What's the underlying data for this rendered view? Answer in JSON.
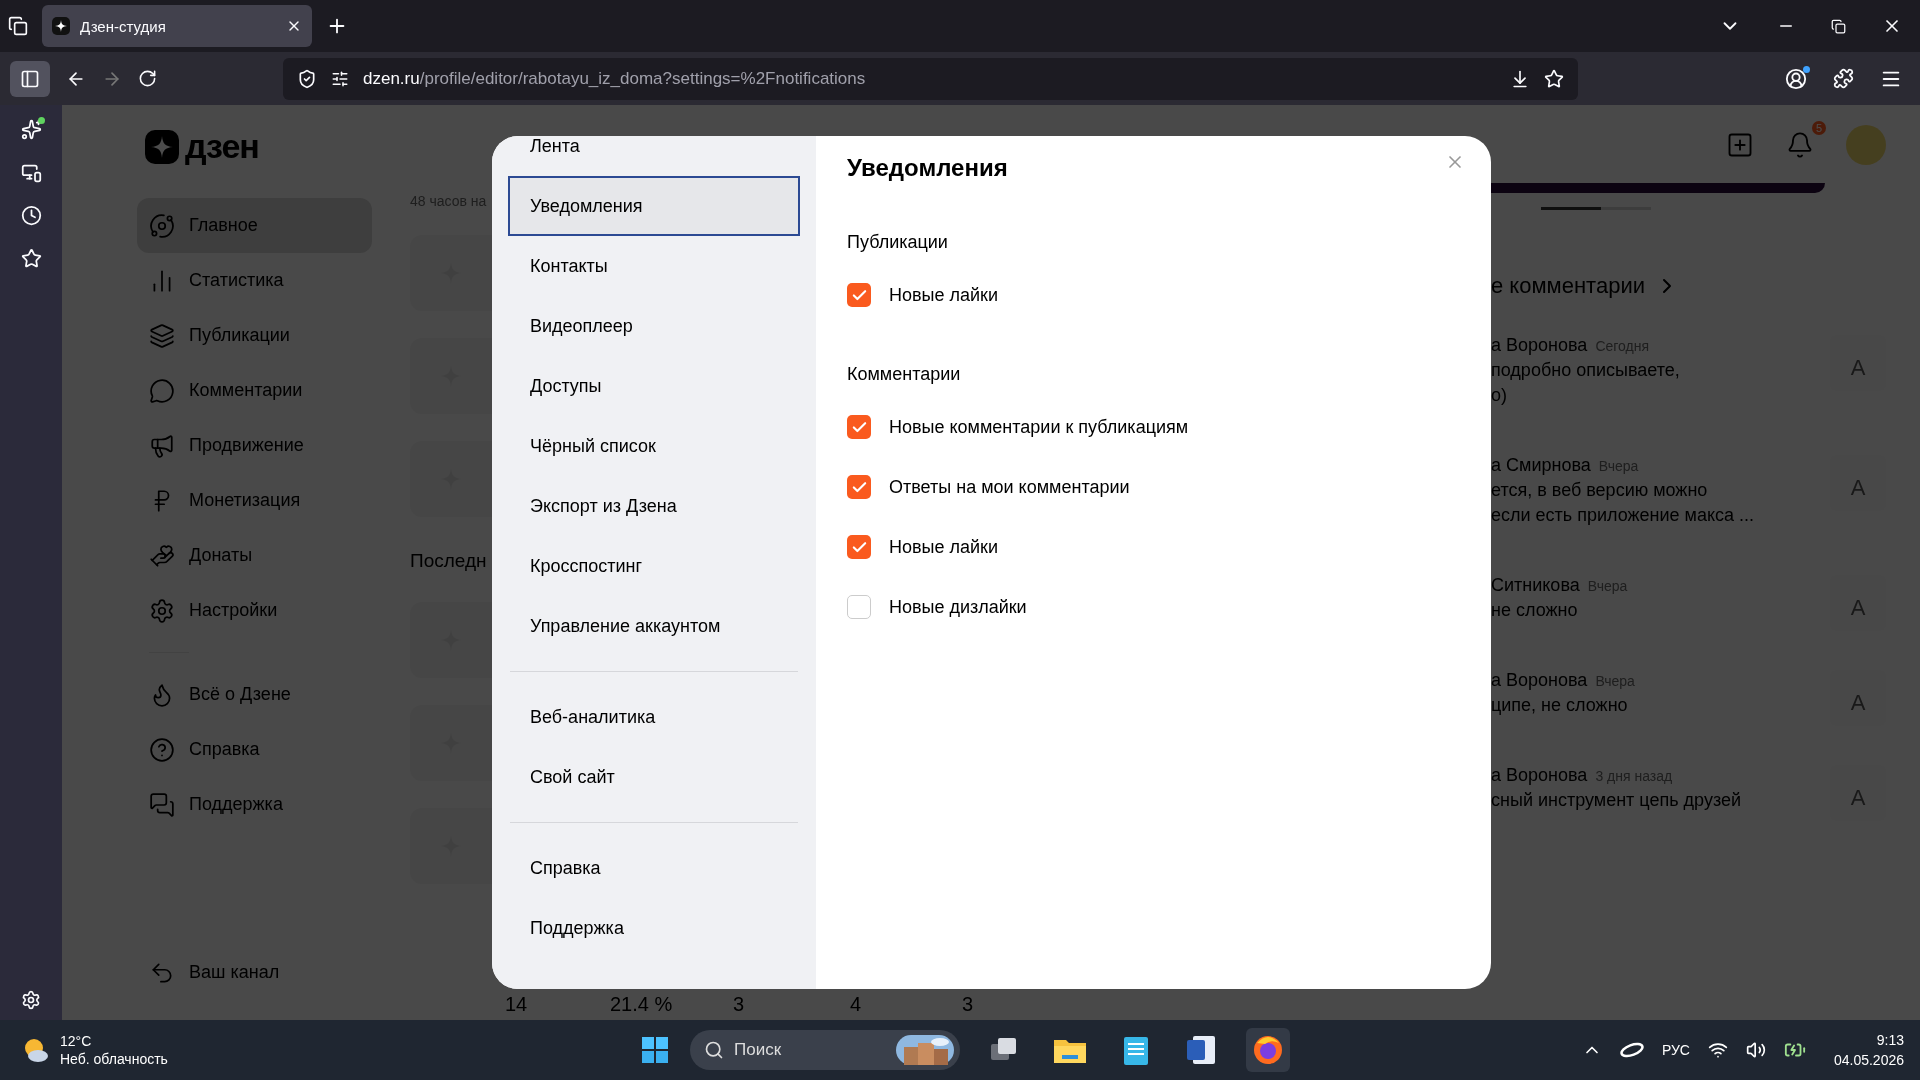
{
  "browser": {
    "tab_title": "Дзен-студия",
    "url_domain": "dzen.ru",
    "url_path": "/profile/editor/rabotayu_iz_doma?settings=%2Fnotifications"
  },
  "page": {
    "logo": "дзен",
    "nav": [
      {
        "label": "Главное",
        "selected": true
      },
      {
        "label": "Статистика",
        "selected": false
      },
      {
        "label": "Публикации",
        "selected": false
      },
      {
        "label": "Комментарии",
        "selected": false
      },
      {
        "label": "Продвижение",
        "selected": false
      },
      {
        "label": "Монетизация",
        "selected": false
      },
      {
        "label": "Донаты",
        "selected": false
      },
      {
        "label": "Настройки",
        "selected": false
      }
    ],
    "nav_secondary": [
      "Всё о Дзене",
      "Справка",
      "Поддержка"
    ],
    "channel_link": "Ваш канал",
    "stats_caption": "48 часов на",
    "recent_heading": "Последн",
    "table_row": [
      "14",
      "21.4 %",
      "3",
      "4",
      "3"
    ],
    "notification_count": "5",
    "comments_heading": "е комментарии",
    "comments": [
      {
        "author": "а Воронова",
        "date": "Сегодня",
        "lines": [
          "подробно описываете,",
          "о)"
        ],
        "avatar": "A"
      },
      {
        "author": "а Смирнова",
        "date": "Вчера",
        "lines": [
          "ется, в веб версию можно",
          "если есть приложение макса ..."
        ],
        "avatar": "A"
      },
      {
        "author": "Ситникова",
        "date": "Вчера",
        "lines": [
          "не сложно"
        ],
        "avatar": "A"
      },
      {
        "author": "а Воронова",
        "date": "Вчера",
        "lines": [
          "ципе, не сложно"
        ],
        "avatar": "A"
      },
      {
        "author": "а Воронова",
        "date": "3 дня назад",
        "lines": [
          "сный инструмент цепь друзей"
        ],
        "avatar": "A"
      }
    ]
  },
  "modal": {
    "nav_groups": [
      {
        "items": [
          {
            "label": "Лента",
            "selected": false
          },
          {
            "label": "Уведомления",
            "selected": true
          },
          {
            "label": "Контакты",
            "selected": false
          },
          {
            "label": "Видеоплеер",
            "selected": false
          },
          {
            "label": "Доступы",
            "selected": false
          },
          {
            "label": "Чёрный список",
            "selected": false
          },
          {
            "label": "Экспорт из Дзена",
            "selected": false
          },
          {
            "label": "Кросспостинг",
            "selected": false
          },
          {
            "label": "Управление аккаунтом",
            "selected": false
          }
        ]
      },
      {
        "items": [
          {
            "label": "Веб-аналитика",
            "selected": false
          },
          {
            "label": "Свой сайт",
            "selected": false
          }
        ]
      },
      {
        "items": [
          {
            "label": "Справка",
            "selected": false
          },
          {
            "label": "Поддержка",
            "selected": false
          }
        ]
      }
    ],
    "title": "Уведомления",
    "sections": [
      {
        "heading": "Публикации",
        "options": [
          {
            "label": "Новые лайки",
            "checked": true
          }
        ]
      },
      {
        "heading": "Комментарии",
        "options": [
          {
            "label": "Новые комментарии к публикациям",
            "checked": true
          },
          {
            "label": "Ответы на мои комментарии",
            "checked": true
          },
          {
            "label": "Новые лайки",
            "checked": true
          },
          {
            "label": "Новые дизлайки",
            "checked": false
          }
        ]
      }
    ]
  },
  "taskbar": {
    "temperature": "12°C",
    "weather": "Неб. облачность",
    "search_placeholder": "Поиск",
    "language": "РУС",
    "time": "9:13",
    "date": "04.05.2026"
  }
}
